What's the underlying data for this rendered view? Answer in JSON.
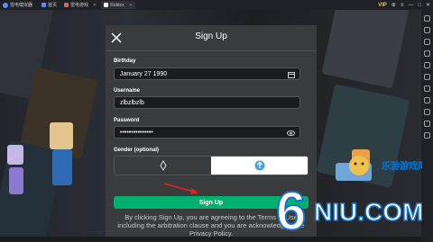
{
  "titlebar": {
    "app_name": "雷电模拟器",
    "tabs": [
      {
        "label": "首页",
        "color": "#5b8cff"
      },
      {
        "label": "雷电游戏",
        "color": "#e85a5a"
      },
      {
        "label": "Roblox",
        "color": "#f0f0f0"
      }
    ],
    "badge": "VIP"
  },
  "modal": {
    "title": "Sign Up",
    "birthday_label": "Birthday",
    "birthday_value": "January 27 1990",
    "username_label": "Username",
    "username_value": "zlbzlbzlb",
    "password_label": "Password",
    "password_value": "•••••••••••••••",
    "gender_label": "Gender (optional)",
    "gender_selected": "male",
    "signup_label": "Sign Up",
    "legal_text": "By clicking Sign Up, you are agreeing to the Terms of Use including the arbitration clause and you are acknowledging the Privacy Policy."
  },
  "watermark": {
    "brand": "6NIU.COM",
    "cn_text": "乐游游戏网"
  },
  "colors": {
    "accent_green": "#00b06f",
    "modal_bg": "#393b3d",
    "field_bg": "#191b1d"
  }
}
